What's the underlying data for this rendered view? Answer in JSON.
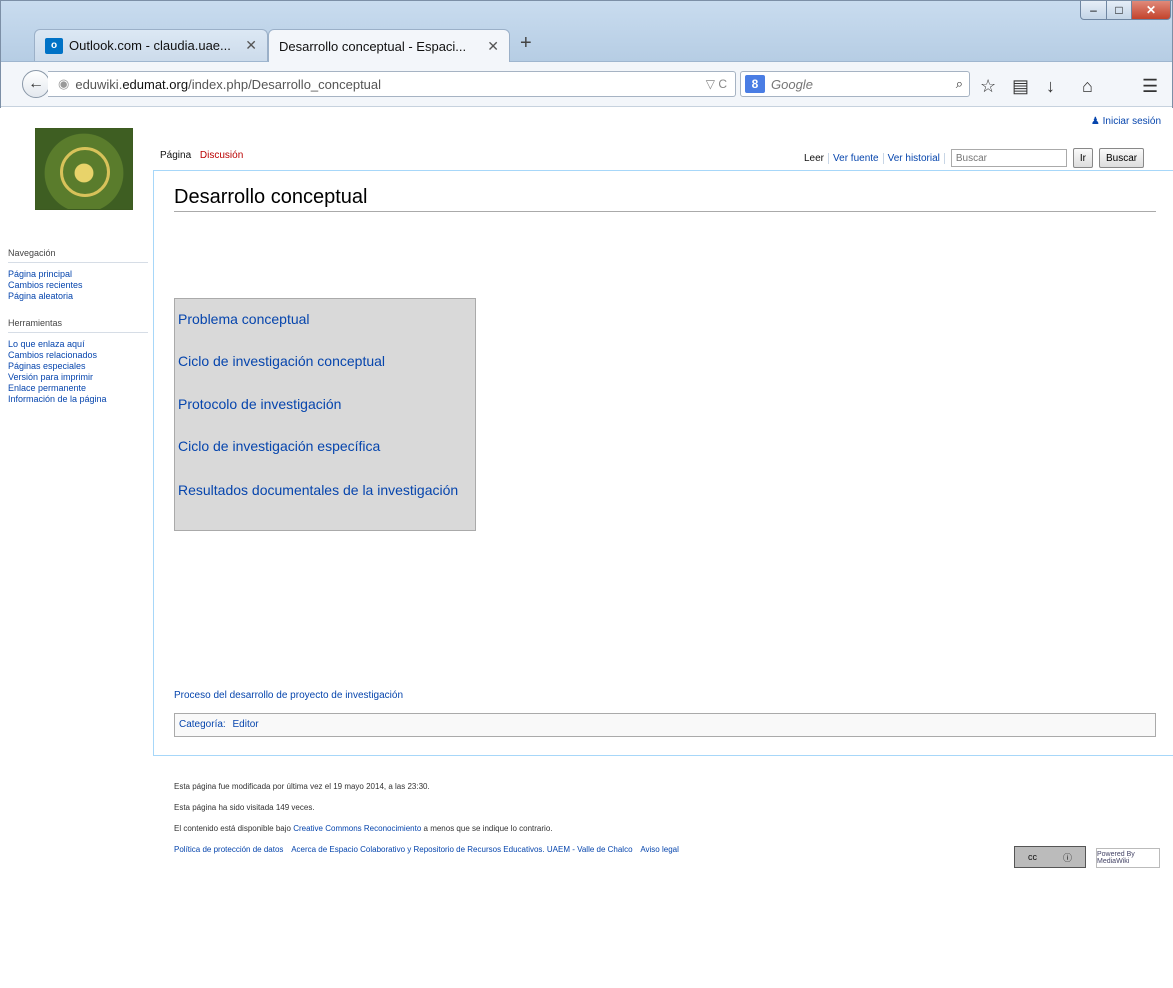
{
  "browser": {
    "tabs": [
      {
        "label": "Outlook.com - claudia.uae...",
        "icon": "outlook-icon"
      },
      {
        "label": "Desarrollo conceptual - Espaci...",
        "active": true
      }
    ],
    "url_prefix": "eduwiki.",
    "url_domain": "edumat.org",
    "url_path": "/index.php/Desarrollo_conceptual",
    "search_placeholder": "Google",
    "search_engine_icon": "8"
  },
  "wiki": {
    "login": "Iniciar sesión",
    "tabs_left": {
      "page": "Página",
      "talk": "Discusión"
    },
    "tabs_right": {
      "read": "Leer",
      "source": "Ver fuente",
      "history": "Ver historial"
    },
    "search_placeholder": "Buscar",
    "go_button": "Ir",
    "search_button": "Buscar",
    "title": "Desarrollo conceptual",
    "sidebar": {
      "nav_heading": "Navegación",
      "nav_items": [
        "Página principal",
        "Cambios recientes",
        "Página aleatoria"
      ],
      "tools_heading": "Herramientas",
      "tools_items": [
        "Lo que enlaza aquí",
        "Cambios relacionados",
        "Páginas especiales",
        "Versión para imprimir",
        "Enlace permanente",
        "Información de la página"
      ]
    },
    "links": [
      "Problema conceptual",
      "Ciclo de investigación conceptual",
      "Protocolo de investigación",
      "Ciclo de investigación específica",
      "Resultados documentales de la investigación"
    ],
    "process_link": "Proceso del desarrollo de proyecto de investigación",
    "category_label": "Categoría:",
    "category_value": "Editor",
    "footer": {
      "modified": "Esta página fue modificada por última vez el 19 mayo 2014, a las 23:30.",
      "visits": "Esta página ha sido visitada 149 veces.",
      "license_pre": "El contenido está disponible bajo",
      "license_link": "Creative Commons Reconocimiento",
      "license_post": "a menos que se indique lo contrario.",
      "links": [
        "Política de protección de datos",
        "Acerca de Espacio Colaborativo y Repositorio de Recursos Educativos. UAEM - Valle de Chalco",
        "Aviso legal"
      ],
      "cc_badge": "cc",
      "mw_badge": "Powered By MediaWiki"
    }
  }
}
